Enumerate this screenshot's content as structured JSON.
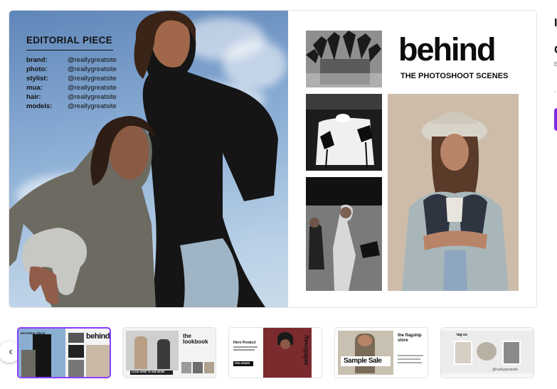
{
  "preview": {
    "heading": "EDITORIAL PIECE",
    "credits": [
      {
        "role": "brand:",
        "handle": "@reallygreatsite"
      },
      {
        "role": "photo:",
        "handle": "@reallygreatsite"
      },
      {
        "role": "stylist:",
        "handle": "@reallygreatsite"
      },
      {
        "role": "mua:",
        "handle": "@reallygreatsite"
      },
      {
        "role": "hair:",
        "handle": "@reallygreatsite"
      },
      {
        "role": "models:",
        "handle": "@reallygreatsite"
      }
    ],
    "title": "behind",
    "subtitle": "THE PHOTOSHOOT SCENES"
  },
  "thumbnails": {
    "prev_icon": "chevron-left-icon",
    "items": [
      {
        "title": "behind",
        "label": "EDITORIAL PIECE",
        "selected": true
      },
      {
        "title": "the lookbook",
        "label": "CLICK HERE TO SEE MORE",
        "selected": false
      },
      {
        "title": "Newspaper",
        "label": "Hero Product",
        "button": "PRE-ORDER",
        "selected": false
      },
      {
        "title": "Sample Sale",
        "label": "the flagship store",
        "selected": false
      },
      {
        "title": "tag us",
        "label": "@reallygreatsite",
        "selected": false
      }
    ]
  },
  "colors": {
    "accent": "#8b3dff",
    "edge_button": "#7d2ae8"
  }
}
